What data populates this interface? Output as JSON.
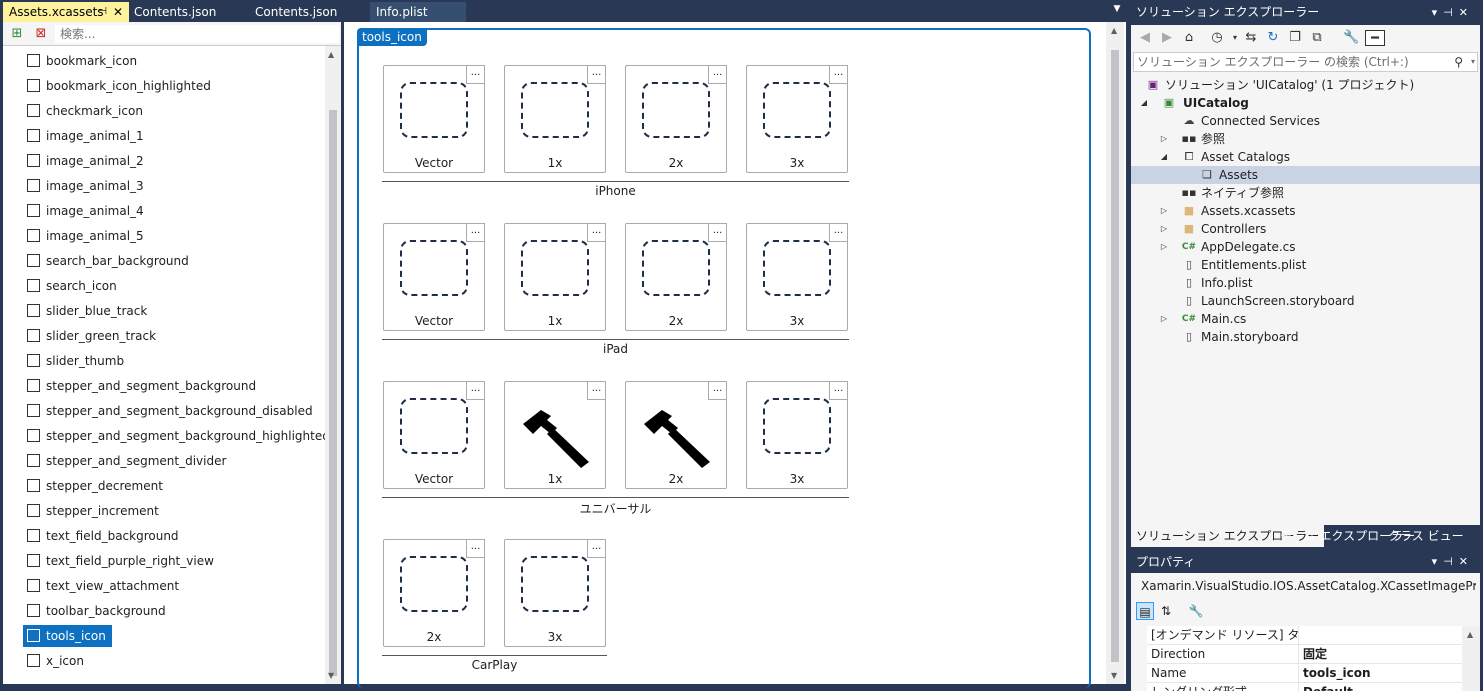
{
  "tabs": [
    {
      "label": "Assets.xcassets",
      "active": true
    },
    {
      "label": "Contents.json"
    },
    {
      "label": "Contents.json"
    },
    {
      "label": "Info.plist"
    }
  ],
  "asset_panel": {
    "search_placeholder": "検索...",
    "items": [
      "bookmark_icon",
      "bookmark_icon_highlighted",
      "checkmark_icon",
      "image_animal_1",
      "image_animal_2",
      "image_animal_3",
      "image_animal_4",
      "image_animal_5",
      "search_bar_background",
      "search_icon",
      "slider_blue_track",
      "slider_green_track",
      "slider_thumb",
      "stepper_and_segment_background",
      "stepper_and_segment_background_disabled",
      "stepper_and_segment_background_highlighted",
      "stepper_and_segment_divider",
      "stepper_decrement",
      "stepper_increment",
      "text_field_background",
      "text_field_purple_right_view",
      "text_view_attachment",
      "toolbar_background",
      "tools_icon",
      "x_icon"
    ],
    "selected": "tools_icon"
  },
  "editor": {
    "set_name": "tools_icon",
    "more_label": "...",
    "groups": [
      {
        "name": "iPhone",
        "slots": [
          {
            "label": "Vector"
          },
          {
            "label": "1x"
          },
          {
            "label": "2x"
          },
          {
            "label": "3x"
          }
        ]
      },
      {
        "name": "iPad",
        "slots": [
          {
            "label": "Vector"
          },
          {
            "label": "1x"
          },
          {
            "label": "2x"
          },
          {
            "label": "3x"
          }
        ]
      },
      {
        "name": "ユニバーサル",
        "slots": [
          {
            "label": "Vector"
          },
          {
            "label": "1x",
            "image": "hammer-icon"
          },
          {
            "label": "2x",
            "image": "hammer-icon"
          },
          {
            "label": "3x"
          }
        ]
      },
      {
        "name": "CarPlay",
        "slots": [
          {
            "label": "2x"
          },
          {
            "label": "3x"
          }
        ]
      }
    ]
  },
  "solution_explorer": {
    "title": "ソリューション エクスプローラー",
    "search_placeholder": "ソリューション エクスプローラー の検索 (Ctrl+:)",
    "tree": [
      {
        "label": "ソリューション 'UICatalog' (1 プロジェクト)",
        "icon": "solution-icon"
      },
      {
        "label": "UICatalog",
        "icon": "project-icon",
        "bold": true
      },
      {
        "label": "Connected Services",
        "icon": "cloud-icon"
      },
      {
        "label": "参照",
        "icon": "reference-icon"
      },
      {
        "label": "Asset Catalogs",
        "icon": "asset-catalog-icon"
      },
      {
        "label": "Assets",
        "icon": "asset-icon",
        "selected": true
      },
      {
        "label": "ネイティブ参照",
        "icon": "reference-icon"
      },
      {
        "label": "Assets.xcassets",
        "icon": "folder-icon"
      },
      {
        "label": "Controllers",
        "icon": "folder-icon"
      },
      {
        "label": "AppDelegate.cs",
        "icon": "csharp-icon"
      },
      {
        "label": "Entitlements.plist",
        "icon": "file-icon"
      },
      {
        "label": "Info.plist",
        "icon": "file-icon"
      },
      {
        "label": "LaunchScreen.storyboard",
        "icon": "file-icon"
      },
      {
        "label": "Main.cs",
        "icon": "csharp-icon"
      },
      {
        "label": "Main.storyboard",
        "icon": "file-icon"
      }
    ],
    "bottom_tabs": [
      {
        "label": "ソリューション エクスプローラー",
        "active": true
      },
      {
        "label": "チーム エクスプローラー"
      },
      {
        "label": "クラス ビュー"
      }
    ]
  },
  "properties": {
    "title": "プロパティ",
    "object_type": "Xamarin.VisualStudio.IOS.AssetCatalog.XCassetImageProperti",
    "rows": [
      {
        "key": "[オンデマンド リソース] タグ",
        "value": ""
      },
      {
        "key": "Direction",
        "value": "固定"
      },
      {
        "key": "Name",
        "value": "tools_icon"
      },
      {
        "key": "レンダリング形式",
        "value": "Default"
      }
    ]
  },
  "colors": {
    "accent": "#0e70c0",
    "chrome": "#293955",
    "active_tab": "#fff29d"
  }
}
